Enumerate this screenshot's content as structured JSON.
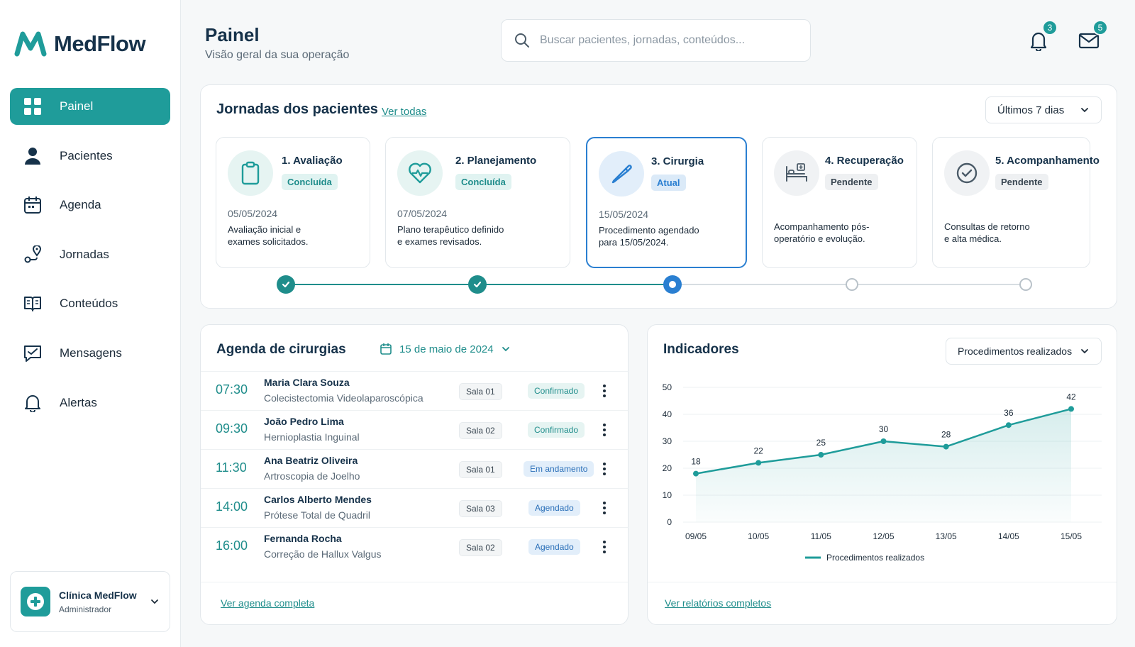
{
  "brand": {
    "name": "MedFlow"
  },
  "nav": [
    {
      "label": "Painel",
      "icon": "grid-icon",
      "active": true
    },
    {
      "label": "Pacientes",
      "icon": "person-icon"
    },
    {
      "label": "Agenda",
      "icon": "calendar-icon"
    },
    {
      "label": "Jornadas",
      "icon": "route-icon"
    },
    {
      "label": "Conteúdos",
      "icon": "book-icon"
    },
    {
      "label": "Mensagens",
      "icon": "message-icon"
    },
    {
      "label": "Alertas",
      "icon": "bell-icon"
    }
  ],
  "clinic": {
    "name": "Clínica MedFlow",
    "role": "Administrador"
  },
  "header": {
    "title": "Painel",
    "subtitle": "Visão geral da sua operação",
    "search_placeholder": "Buscar pacientes, jornadas, conteúdos...",
    "notifications_count": "3",
    "messages_count": "5"
  },
  "journeys": {
    "title": "Jornadas dos pacientes",
    "see_all": "Ver todas",
    "period": "Últimos 7 dias",
    "stages": [
      {
        "title": "1. Avaliação",
        "status": "Concluída",
        "state": "done",
        "date": "05/05/2024",
        "desc_1": "Avaliação inicial e",
        "desc_2": "exames solicitados.",
        "icon": "clipboard-icon"
      },
      {
        "title": "2. Planejamento",
        "status": "Concluída",
        "state": "done",
        "date": "07/05/2024",
        "desc_1": "Plano terapêutico definido",
        "desc_2": "e exames revisados.",
        "icon": "heart-pulse-icon"
      },
      {
        "title": "3. Cirurgia",
        "status": "Atual",
        "state": "current",
        "date": "15/05/2024",
        "desc_1": "Procedimento agendado",
        "desc_2": "para 15/05/2024.",
        "icon": "scalpel-icon"
      },
      {
        "title": "4. Recuperação",
        "status": "Pendente",
        "state": "pending",
        "date": "",
        "desc_1": "Acompanhamento pós-",
        "desc_2": "operatório e evolução.",
        "icon": "hospital-bed-icon"
      },
      {
        "title": "5. Acompanhamento",
        "status": "Pendente",
        "state": "pending",
        "date": "",
        "desc_1": "Consultas de retorno",
        "desc_2": "e alta médica.",
        "icon": "check-circle-icon"
      }
    ]
  },
  "agenda": {
    "title": "Agenda de cirurgias",
    "date": "15 de maio de 2024",
    "see_full": "Ver agenda completa",
    "rows": [
      {
        "time": "07:30",
        "patient": "Maria Clara Souza",
        "procedure": "Colecistectomia Videolaparoscópica",
        "room": "Sala 01",
        "status": "Confirmado",
        "kind": "conf"
      },
      {
        "time": "09:30",
        "patient": "João Pedro Lima",
        "procedure": "Hernioplastia Inguinal",
        "room": "Sala 02",
        "status": "Confirmado",
        "kind": "conf"
      },
      {
        "time": "11:30",
        "patient": "Ana Beatriz Oliveira",
        "procedure": "Artroscopia de Joelho",
        "room": "Sala 01",
        "status": "Em andamento",
        "kind": "prog"
      },
      {
        "time": "14:00",
        "patient": "Carlos Alberto Mendes",
        "procedure": "Prótese Total de Quadril",
        "room": "Sala 03",
        "status": "Agendado",
        "kind": "sched"
      },
      {
        "time": "16:00",
        "patient": "Fernanda Rocha",
        "procedure": "Correção de Hallux Valgus",
        "room": "Sala 02",
        "status": "Agendado",
        "kind": "sched"
      }
    ]
  },
  "indicators": {
    "title": "Indicadores",
    "metric": "Procedimentos realizados",
    "see_reports": "Ver relatórios completos"
  },
  "chart_data": {
    "type": "area",
    "categories": [
      "09/05",
      "10/05",
      "11/05",
      "12/05",
      "13/05",
      "14/05",
      "15/05"
    ],
    "series": [
      {
        "name": "Procedimentos realizados",
        "values": [
          18,
          22,
          25,
          30,
          28,
          36,
          42
        ]
      }
    ],
    "ylim": [
      0,
      50
    ],
    "yticks": [
      0,
      10,
      20,
      30,
      40,
      50
    ],
    "grid": true,
    "legend": "bottom",
    "color": "#1f9c9a"
  },
  "colors": {
    "accent": "#1f9c9a",
    "current": "#2a7fd1",
    "text": "#16324a"
  }
}
